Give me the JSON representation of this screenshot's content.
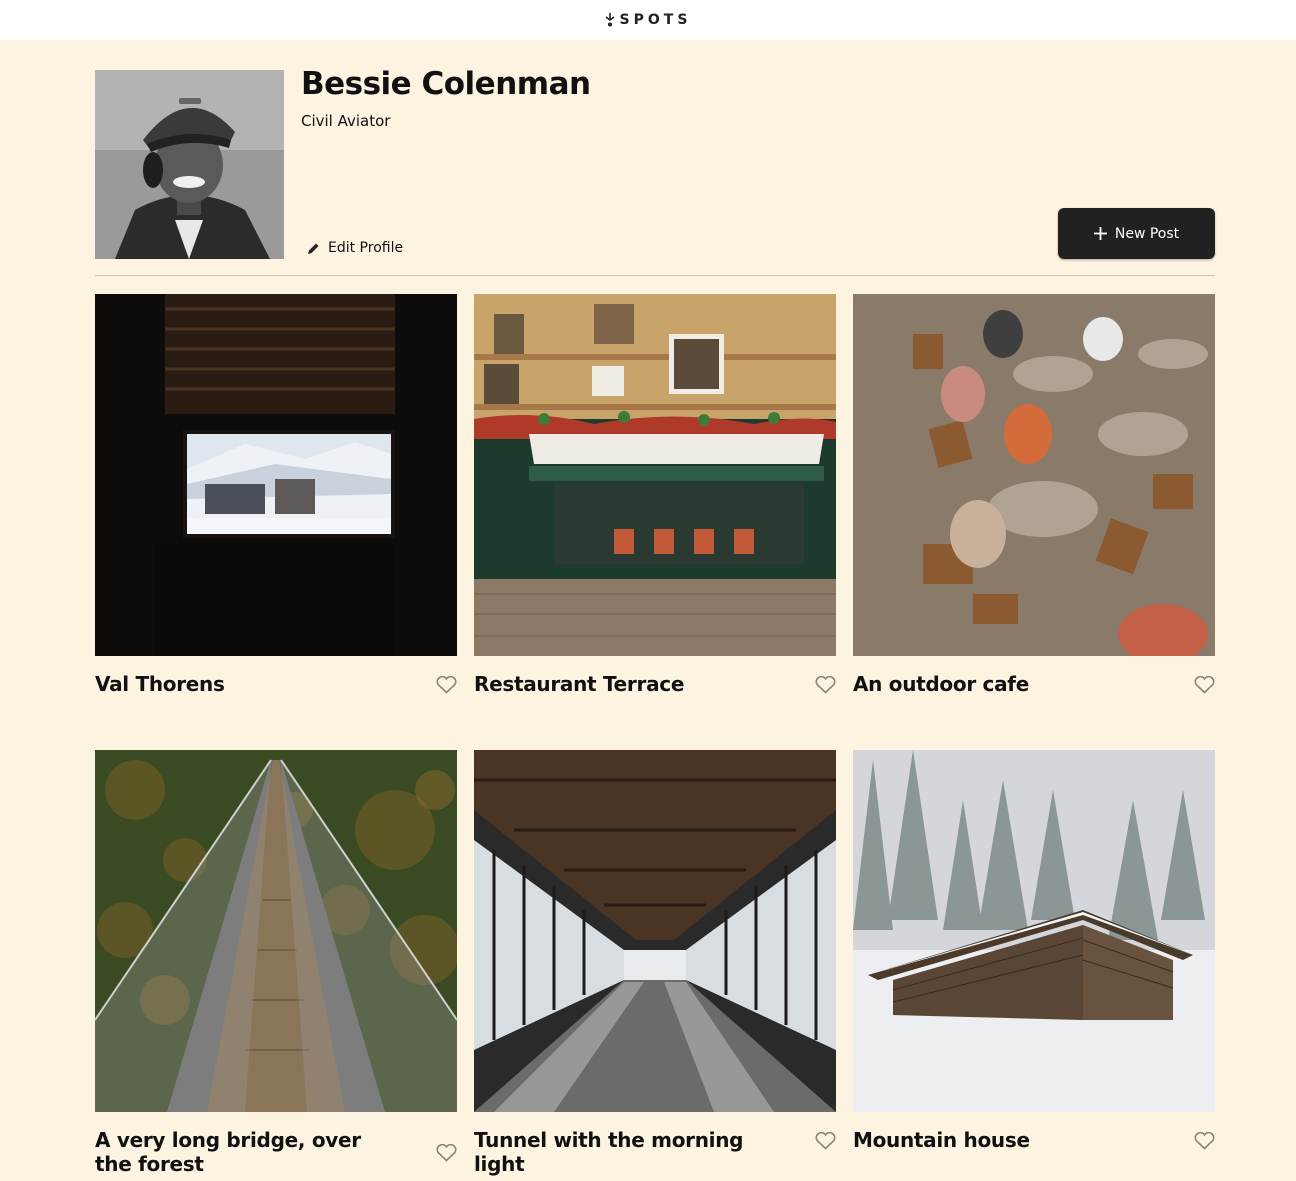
{
  "header": {
    "logo_text": "SPOTS"
  },
  "profile": {
    "name": "Bessie Colenman",
    "description": "Civil Aviator",
    "edit_label": "Edit Profile",
    "new_post_label": "New Post"
  },
  "cards": [
    {
      "title": "Val Thorens",
      "liked": false
    },
    {
      "title": "Restaurant Terrace",
      "liked": false
    },
    {
      "title": "An outdoor cafe",
      "liked": false
    },
    {
      "title": "A very long bridge, over the forest",
      "liked": false
    },
    {
      "title": "Tunnel with the morning light",
      "liked": false
    },
    {
      "title": "Mountain house",
      "liked": false
    }
  ],
  "colors": {
    "background": "#fcf3e0",
    "button": "#212121",
    "header": "#ffffff"
  },
  "icons": {
    "logo": "spots-logo-icon",
    "edit": "pencil-icon",
    "add": "plus-icon",
    "like": "heart-outline-icon"
  }
}
